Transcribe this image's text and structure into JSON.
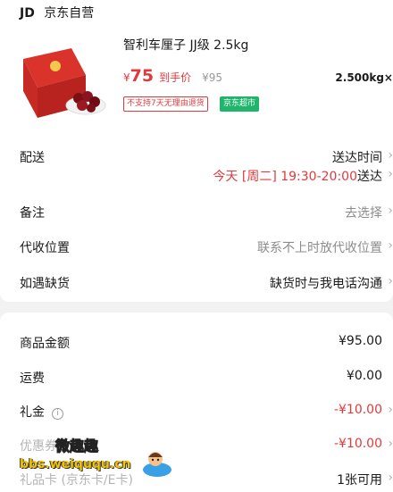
{
  "store": {
    "logo": "JD",
    "name": "京东自营"
  },
  "product": {
    "title": "智利车厘子 JJ级 2.5kg",
    "price_symbol": "¥",
    "price": "75",
    "price_tag": "到手价",
    "original_price": "¥95",
    "weight": "2.500kg×",
    "badge_no_return": "不支持7天无理由退货",
    "badge_supermarket": "京东超市"
  },
  "rows": {
    "delivery": {
      "label": "配送",
      "value": "送达时间",
      "time_red": "今天 [周二] 19:30-20:00",
      "time_suffix": "送达"
    },
    "note": {
      "label": "备注",
      "value": "去选择"
    },
    "collection": {
      "label": "代收位置",
      "value": "联系不上时放代收位置"
    },
    "stockout": {
      "label": "如遇缺货",
      "value": "缺货时与我电话沟通"
    }
  },
  "summary": {
    "goods_amount": {
      "label": "商品金额",
      "value": "¥95.00"
    },
    "shipping": {
      "label": "运费",
      "value": "¥0.00"
    },
    "gift": {
      "label": "礼金",
      "value": "-¥10.00"
    },
    "coupon": {
      "label": "优惠券",
      "value": "-¥10.00"
    },
    "gift_card": {
      "label": "礼品卡 (京东卡/E卡)",
      "value": "1张可用"
    }
  },
  "watermark": {
    "line1": "微趣趣",
    "line2": "bbs.weiququ.cn"
  },
  "colors": {
    "accent_red": "#e4393c",
    "green_badge": "#1fb56b"
  }
}
